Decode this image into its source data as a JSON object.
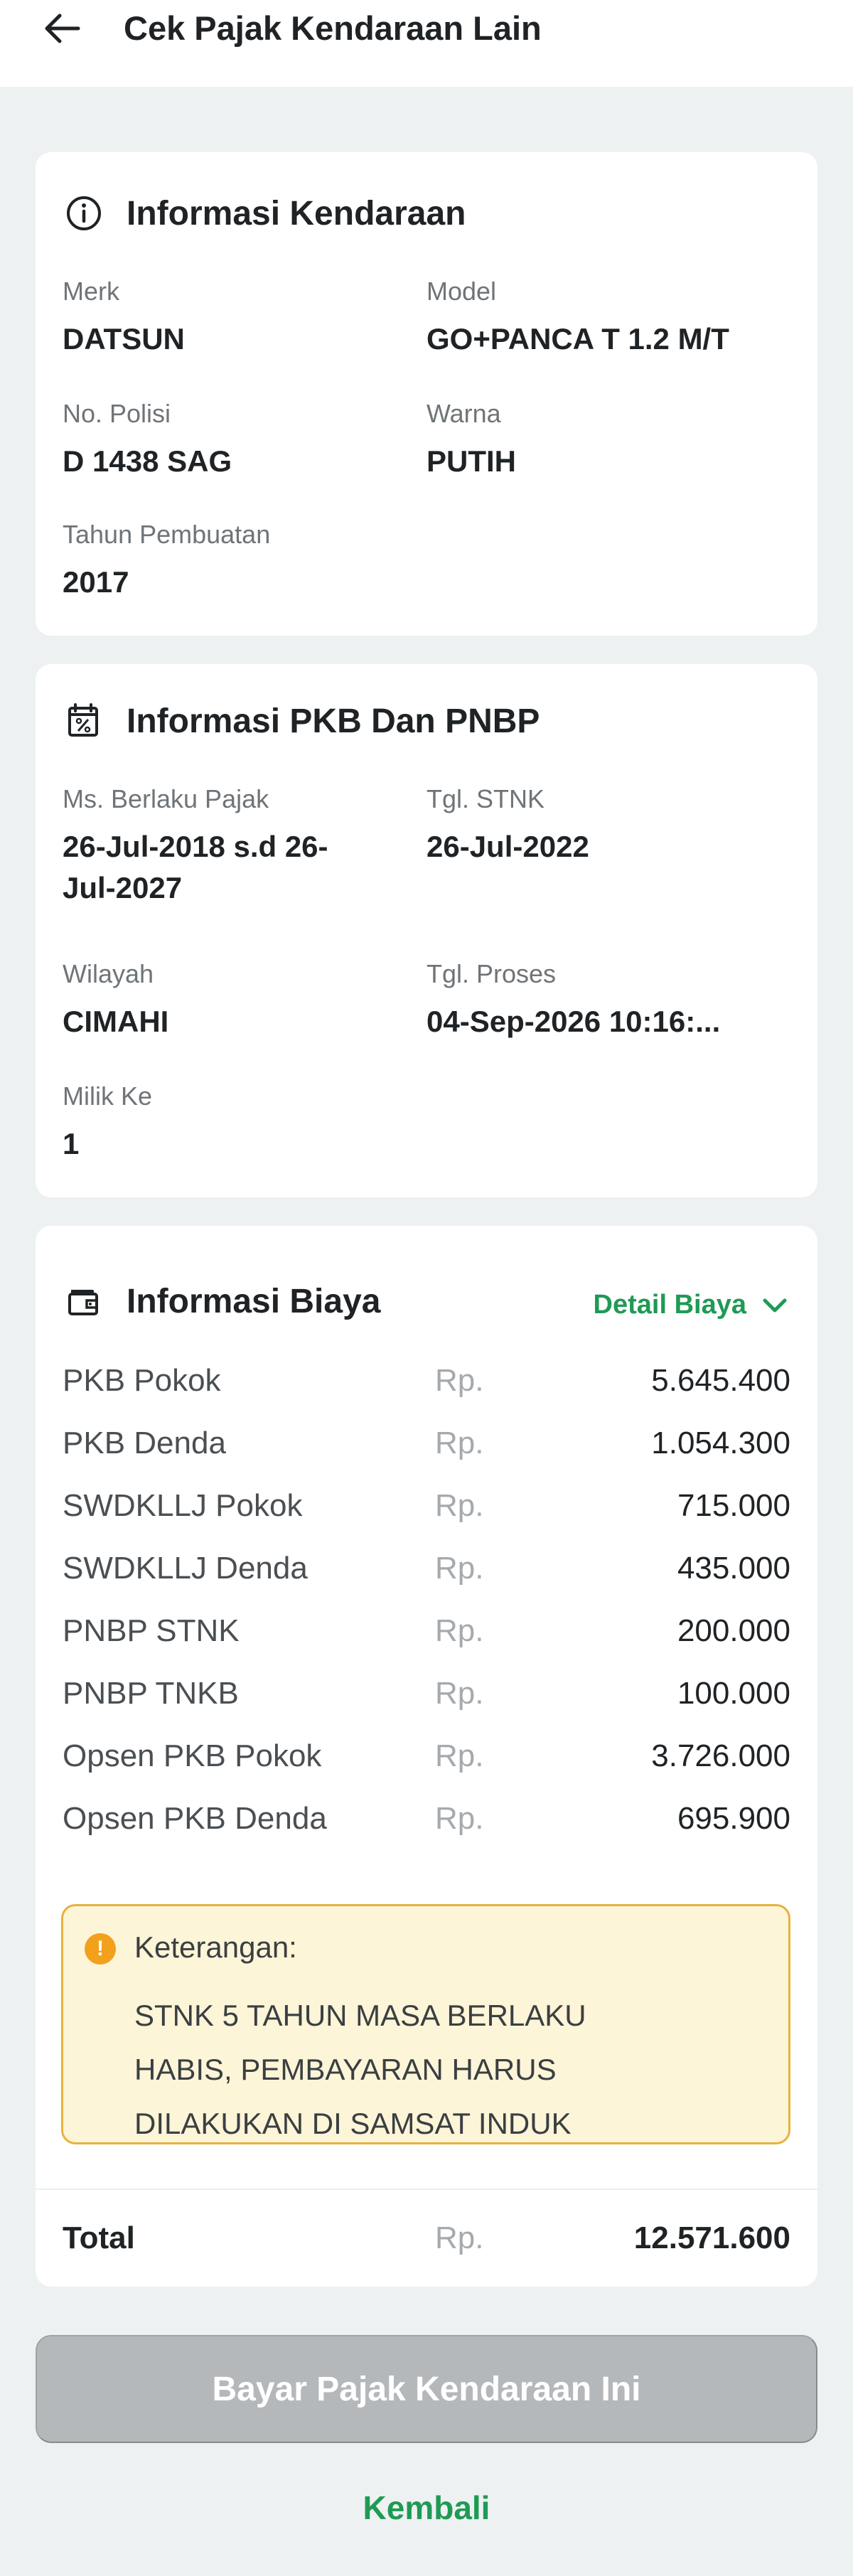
{
  "header": {
    "title": "Cek Pajak Kendaraan Lain",
    "back_icon": "arrow-left-icon"
  },
  "vehicle_info": {
    "title": "Informasi Kendaraan",
    "icon": "info-circle-icon",
    "fields": {
      "merk": {
        "label": "Merk",
        "value": "DATSUN"
      },
      "model": {
        "label": "Model",
        "value": "GO+PANCA T 1.2 M/T"
      },
      "no_polisi": {
        "label": "No. Polisi",
        "value": "D 1438 SAG"
      },
      "warna": {
        "label": "Warna",
        "value": "PUTIH"
      },
      "tahun": {
        "label": "Tahun Pembuatan",
        "value": "2017"
      }
    }
  },
  "pkb_info": {
    "title": "Informasi PKB Dan PNBP",
    "icon": "tax-percent-icon",
    "fields": {
      "masa_berlaku": {
        "label": "Ms. Berlaku Pajak",
        "value_line1": "26-Jul-2018 s.d 26-",
        "value_line2": "Jul-2027"
      },
      "tgl_stnk": {
        "label": "Tgl. STNK",
        "value": "26-Jul-2022"
      },
      "wilayah": {
        "label": "Wilayah",
        "value": "CIMAHI"
      },
      "tgl_proses": {
        "label": "Tgl. Proses",
        "value": "04-Sep-2026 10:16:..."
      },
      "milik_ke": {
        "label": "Milik Ke",
        "value": "1"
      }
    }
  },
  "biaya": {
    "title": "Informasi Biaya",
    "icon": "wallet-icon",
    "detail_label": "Detail Biaya",
    "currency": "Rp.",
    "rows": [
      {
        "label": "PKB Pokok",
        "amount": "5.645.400"
      },
      {
        "label": "PKB Denda",
        "amount": "1.054.300"
      },
      {
        "label": "SWDKLLJ Pokok",
        "amount": "715.000"
      },
      {
        "label": "SWDKLLJ Denda",
        "amount": "435.000"
      },
      {
        "label": "PNBP STNK",
        "amount": "200.000"
      },
      {
        "label": "PNBP TNKB",
        "amount": "100.000"
      },
      {
        "label": "Opsen PKB Pokok",
        "amount": "3.726.000"
      },
      {
        "label": "Opsen PKB Denda",
        "amount": "695.900"
      }
    ],
    "note": {
      "title": "Keterangan:",
      "text_line1": "STNK 5 TAHUN MASA BERLAKU",
      "text_line2": "HABIS, PEMBAYARAN HARUS",
      "text_line3": "DILAKUKAN DI SAMSAT INDUK"
    },
    "total": {
      "label": "Total",
      "amount": "12.571.600"
    }
  },
  "actions": {
    "pay_label": "Bayar Pajak Kendaraan Ini",
    "back_label": "Kembali"
  },
  "colors": {
    "accent_green": "#1f9a55",
    "note_border": "#e7b23d",
    "note_bg": "#fdf5d8",
    "disabled_button": "#b5b8ba"
  }
}
